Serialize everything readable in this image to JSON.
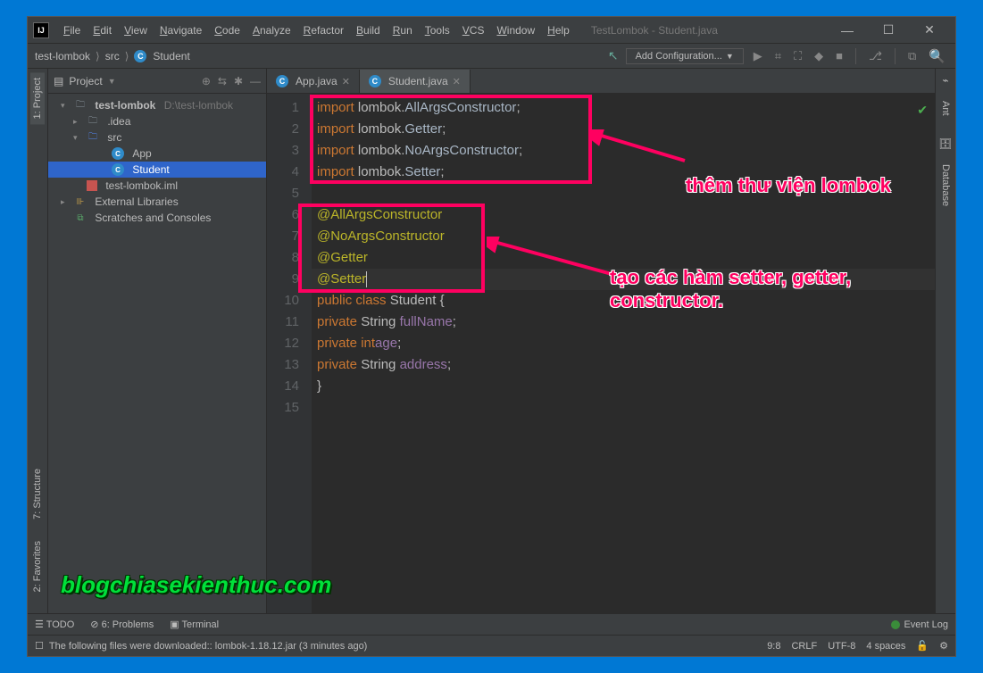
{
  "window": {
    "title": "TestLombok - Student.java"
  },
  "menu": [
    "File",
    "Edit",
    "View",
    "Navigate",
    "Code",
    "Analyze",
    "Refactor",
    "Build",
    "Run",
    "Tools",
    "VCS",
    "Window",
    "Help"
  ],
  "breadcrumb": [
    "test-lombok",
    "src",
    "Student"
  ],
  "run_config": "Add Configuration...",
  "project_panel": {
    "title": "Project",
    "root_name": "test-lombok",
    "root_path": "D:\\test-lombok",
    "folders": {
      "idea": ".idea",
      "src": "src"
    },
    "classes": [
      "App",
      "Student"
    ],
    "iml_file": "test-lombok.iml",
    "external": "External Libraries",
    "scratches": "Scratches and Consoles"
  },
  "tabs": [
    {
      "label": "App.java",
      "active": false
    },
    {
      "label": "Student.java",
      "active": true
    }
  ],
  "code_lines": [
    {
      "n": 1,
      "t": [
        [
          "kw",
          "import"
        ],
        [
          "",
          " lombok."
        ],
        [
          "cls",
          "AllArgsConstructor"
        ],
        [
          "",
          ";"
        ]
      ]
    },
    {
      "n": 2,
      "t": [
        [
          "kw",
          "import"
        ],
        [
          "",
          " lombok."
        ],
        [
          "cls",
          "Getter"
        ],
        [
          "",
          ";"
        ]
      ]
    },
    {
      "n": 3,
      "t": [
        [
          "kw",
          "import"
        ],
        [
          "",
          " lombok."
        ],
        [
          "cls",
          "NoArgsConstructor"
        ],
        [
          "",
          ";"
        ]
      ]
    },
    {
      "n": 4,
      "t": [
        [
          "kw",
          "import"
        ],
        [
          "",
          " lombok."
        ],
        [
          "cls",
          "Setter"
        ],
        [
          "",
          ";"
        ]
      ]
    },
    {
      "n": 5,
      "t": []
    },
    {
      "n": 6,
      "t": [
        [
          "ann",
          "@AllArgsConstructor"
        ]
      ]
    },
    {
      "n": 7,
      "t": [
        [
          "ann",
          "@NoArgsConstructor"
        ]
      ]
    },
    {
      "n": 8,
      "t": [
        [
          "ann",
          "@Getter"
        ]
      ]
    },
    {
      "n": 9,
      "t": [
        [
          "ann",
          "@Setter"
        ]
      ],
      "current": true
    },
    {
      "n": 10,
      "t": [
        [
          "kw",
          "public class"
        ],
        [
          "",
          " Student {"
        ]
      ]
    },
    {
      "n": 11,
      "t": [
        [
          "",
          "    "
        ],
        [
          "kw",
          "private"
        ],
        [
          "",
          " String "
        ],
        [
          "fld",
          "fullName"
        ],
        [
          "",
          ";"
        ]
      ]
    },
    {
      "n": 12,
      "t": [
        [
          "",
          "    "
        ],
        [
          "kw",
          "private int"
        ],
        [
          "",
          " "
        ],
        [
          "fld",
          "age"
        ],
        [
          "",
          ";"
        ]
      ]
    },
    {
      "n": 13,
      "t": [
        [
          "",
          "    "
        ],
        [
          "kw",
          "private"
        ],
        [
          "",
          " String "
        ],
        [
          "fld",
          "address"
        ],
        [
          "",
          ";"
        ]
      ]
    },
    {
      "n": 14,
      "t": [
        [
          "",
          "}"
        ]
      ]
    },
    {
      "n": 15,
      "t": []
    }
  ],
  "right_tabs": [
    "Ant",
    "Database"
  ],
  "left_tabs": [
    "1: Project",
    "7: Structure",
    "2: Favorites"
  ],
  "bottom_tools": {
    "todo": "TODO",
    "problems": "6: Problems",
    "terminal": "Terminal",
    "event_log": "Event Log"
  },
  "status": {
    "msg": "The following files were downloaded:: lombok-1.18.12.jar (3 minutes ago)",
    "pos": "9:8",
    "line_sep": "CRLF",
    "enc": "UTF-8",
    "indent": "4 spaces"
  },
  "annotations": {
    "a1": "thêm thư viện lombok",
    "a2": "tạo các hàm setter, getter, constructor.",
    "watermark": "blogchiasekienthuc.com"
  }
}
